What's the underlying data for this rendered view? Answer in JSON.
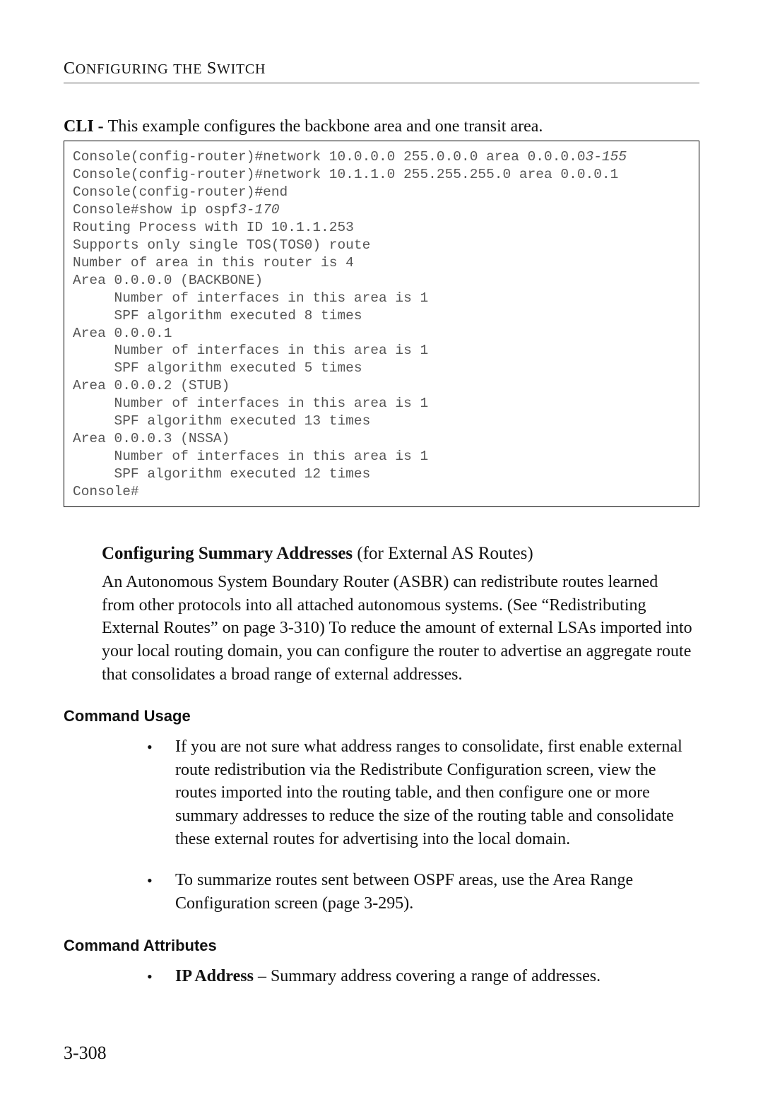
{
  "header": {
    "running_head_html": "C<span class='inner-caps'>ONFIGURING</span> <span class='inner-caps'>THE</span> S<span class='inner-caps'>WITCH</span>"
  },
  "cli_intro": {
    "label": "CLI - ",
    "text": "This example configures the backbone area and one transit area."
  },
  "code_lines": [
    {
      "t": "Console(config-router)#network 10.0.0.0 255.0.0.0 area 0.0.0.0",
      "suffix_it": "3-155"
    },
    {
      "t": "Console(config-router)#network 10.1.1.0 255.255.255.0 area 0.0.0.1"
    },
    {
      "t": "Console(config-router)#end"
    },
    {
      "t": "Console#show ip ospf",
      "suffix_it": "3-170"
    },
    {
      "t": "Routing Process with ID 10.1.1.253"
    },
    {
      "t": "Supports only single TOS(TOS0) route"
    },
    {
      "t": "Number of area in this router is 4"
    },
    {
      "t": "Area 0.0.0.0 (BACKBONE)"
    },
    {
      "t": "     Number of interfaces in this area is 1"
    },
    {
      "t": "     SPF algorithm executed 8 times"
    },
    {
      "t": "Area 0.0.0.1"
    },
    {
      "t": "     Number of interfaces in this area is 1"
    },
    {
      "t": "     SPF algorithm executed 5 times"
    },
    {
      "t": "Area 0.0.0.2 (STUB)"
    },
    {
      "t": "     Number of interfaces in this area is 1"
    },
    {
      "t": "     SPF algorithm executed 13 times"
    },
    {
      "t": "Area 0.0.0.3 (NSSA)"
    },
    {
      "t": "     Number of interfaces in this area is 1"
    },
    {
      "t": "     SPF algorithm executed 12 times"
    },
    {
      "t": "Console#"
    }
  ],
  "section_heading": {
    "bold": "Configuring Summary Addresses",
    "rest": " (for External AS Routes)"
  },
  "main_paragraph": "An Autonomous System Boundary Router (ASBR) can redistribute routes learned from other protocols into all attached autonomous systems. (See “Redistributing External Routes” on page 3-310) To reduce the amount of external LSAs imported into your local routing domain, you can configure the router to advertise an aggregate route that consolidates a broad range of external addresses.",
  "command_usage_heading": "Command Usage",
  "usage_bullets": [
    "If you are not sure what address ranges to consolidate, first enable external route redistribution via the Redistribute Configuration screen, view the routes imported into the routing table, and then configure one or more summary addresses to reduce the size of the routing table and consolidate these external routes for advertising into the local domain.",
    "To summarize routes sent between OSPF areas, use the Area Range Configuration screen (page 3-295)."
  ],
  "command_attributes_heading": "Command Attributes",
  "attribute_bullets": [
    {
      "term": "IP Address",
      "desc": " – Summary address covering a range of addresses."
    }
  ],
  "page_number": "3-308"
}
